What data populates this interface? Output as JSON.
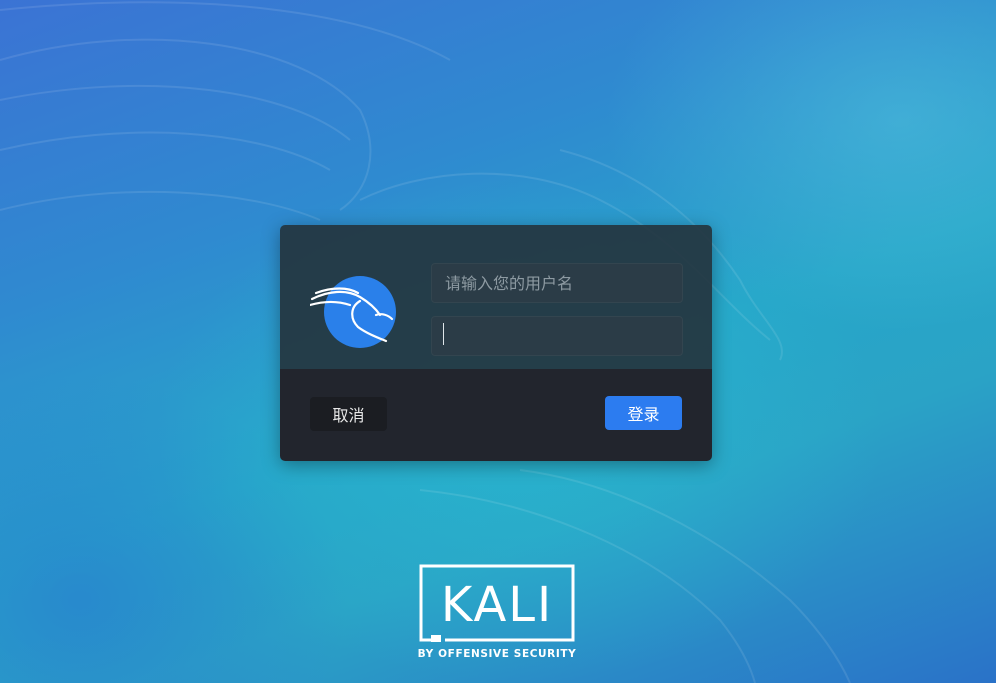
{
  "login_dialog": {
    "username_placeholder": "请输入您的用户名",
    "password_value": "",
    "cancel_label": "取消",
    "login_label": "登录",
    "avatar_icon": "kali-dragon-icon"
  },
  "branding": {
    "logo_text": "KALI",
    "tagline": "BY OFFENSIVE SECURITY"
  },
  "colors": {
    "login_button": "#2c7cf0",
    "avatar_circle": "#2a80ea",
    "dialog_top": "#24343e",
    "dialog_bottom": "#22252d"
  }
}
